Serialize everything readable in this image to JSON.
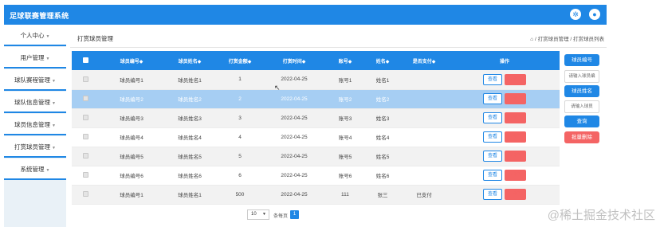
{
  "app": {
    "title": "足球联赛管理系统"
  },
  "header_icons": [
    "gear-icon",
    "user-icon"
  ],
  "sidebar": {
    "items": [
      {
        "label": "个人中心"
      },
      {
        "label": "用户管理"
      },
      {
        "label": "球队赛程管理"
      },
      {
        "label": "球队信息管理"
      },
      {
        "label": "球员信息管理"
      },
      {
        "label": "打赏球员管理"
      },
      {
        "label": "系统管理"
      }
    ]
  },
  "page": {
    "title": "打赏球员管理",
    "breadcrumb": "/ 打赏球员管理 / 打赏球员列表"
  },
  "table": {
    "columns": [
      "球员编号◆",
      "球员姓名◆",
      "打赏金额◆",
      "打赏时间◆",
      "账号◆",
      "姓名◆",
      "是否支付◆",
      "操作"
    ],
    "rows": [
      {
        "c": [
          "球员编号1",
          "球员姓名1",
          "1",
          "2022-04-25",
          "账号1",
          "姓名1",
          ""
        ],
        "state": "white"
      },
      {
        "c": [
          "球员编号2",
          "球员姓名2",
          "2",
          "2022-04-25",
          "账号2",
          "姓名2",
          ""
        ],
        "state": "selected"
      },
      {
        "c": [
          "球员编号3",
          "球员姓名3",
          "3",
          "2022-04-25",
          "账号3",
          "姓名3",
          ""
        ],
        "state": "gray"
      },
      {
        "c": [
          "球员编号4",
          "球员姓名4",
          "4",
          "2022-04-25",
          "账号4",
          "姓名4",
          ""
        ],
        "state": "white"
      },
      {
        "c": [
          "球员编号5",
          "球员姓名5",
          "5",
          "2022-04-25",
          "账号5",
          "姓名5",
          ""
        ],
        "state": "gray"
      },
      {
        "c": [
          "球员编号6",
          "球员姓名6",
          "6",
          "2022-04-25",
          "账号6",
          "姓名6",
          ""
        ],
        "state": "white"
      },
      {
        "c": [
          "球员编号1",
          "球员姓名1",
          "500",
          "2022-04-25",
          "111",
          "张三",
          "已支付"
        ],
        "state": "gray"
      }
    ],
    "view_label": "查看",
    "delete_label": "删除"
  },
  "search": {
    "field1_label": "球员编号",
    "field1_placeholder": "请输入球员编",
    "field2_label": "球员姓名",
    "field2_placeholder": "请输入球员",
    "search_label": "查询",
    "batch_delete_label": "批量删除"
  },
  "pagination": {
    "page_size": "10",
    "page_size_label": "条每页",
    "current_page": "1"
  },
  "watermark": "@稀土掘金技术社区",
  "colors": {
    "primary": "#1f87e5",
    "danger": "#f46464",
    "selected_row": "#a6cef3"
  }
}
